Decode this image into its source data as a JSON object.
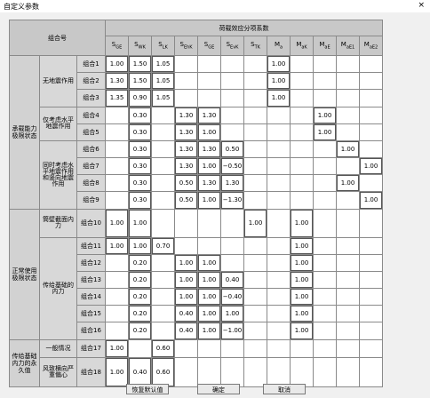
{
  "window": {
    "title": "自定义参数",
    "close_glyph": "×"
  },
  "table": {
    "corner_label": "组合号",
    "coeff_header": "荷载效应分项系数",
    "columns": [
      {
        "main": "S",
        "sub": "GE"
      },
      {
        "main": "S",
        "sub": "WK"
      },
      {
        "main": "S",
        "sub": "LK"
      },
      {
        "main": "S",
        "sub": "EhK"
      },
      {
        "main": "S",
        "sub": "GE"
      },
      {
        "main": "S",
        "sub": "EvK"
      },
      {
        "main": "S",
        "sub": "TK"
      },
      {
        "main": "M",
        "sub": "a"
      },
      {
        "main": "M",
        "sub": "aK"
      },
      {
        "main": "M",
        "sub": "aE"
      },
      {
        "main": "M",
        "sub": "aE1"
      },
      {
        "main": "M",
        "sub": "aE2"
      }
    ],
    "groups": [
      {
        "label": "承载能力极限状态",
        "subs": [
          {
            "label": "无地震作用",
            "rows": [
              {
                "label": "组合1",
                "values": [
                  "1.00",
                  "1.50",
                  "1.05",
                  "",
                  "",
                  "",
                  "",
                  "1.00",
                  "",
                  "",
                  "",
                  ""
                ]
              },
              {
                "label": "组合2",
                "values": [
                  "1.30",
                  "1.50",
                  "1.05",
                  "",
                  "",
                  "",
                  "",
                  "1.00",
                  "",
                  "",
                  "",
                  ""
                ]
              },
              {
                "label": "组合3",
                "values": [
                  "1.35",
                  "0.90",
                  "1.05",
                  "",
                  "",
                  "",
                  "",
                  "1.00",
                  "",
                  "",
                  "",
                  ""
                ]
              }
            ]
          },
          {
            "label": "仅考虑水平地震作用",
            "rows": [
              {
                "label": "组合4",
                "values": [
                  "",
                  "0.30",
                  "",
                  "1.30",
                  "1.30",
                  "",
                  "",
                  "",
                  "",
                  "1.00",
                  "",
                  ""
                ]
              },
              {
                "label": "组合5",
                "values": [
                  "",
                  "0.30",
                  "",
                  "1.30",
                  "1.00",
                  "",
                  "",
                  "",
                  "",
                  "1.00",
                  "",
                  ""
                ]
              }
            ]
          },
          {
            "label": "同时考虑水平地震作用和竖向地震作用",
            "rows": [
              {
                "label": "组合6",
                "values": [
                  "",
                  "0.30",
                  "",
                  "1.30",
                  "1.30",
                  "0.50",
                  "",
                  "",
                  "",
                  "",
                  "1.00",
                  ""
                ]
              },
              {
                "label": "组合7",
                "values": [
                  "",
                  "0.30",
                  "",
                  "1.30",
                  "1.00",
                  "−0.50",
                  "",
                  "",
                  "",
                  "",
                  "",
                  "1.00"
                ]
              },
              {
                "label": "组合8",
                "values": [
                  "",
                  "0.30",
                  "",
                  "0.50",
                  "1.30",
                  "1.30",
                  "",
                  "",
                  "",
                  "",
                  "1.00",
                  ""
                ]
              },
              {
                "label": "组合9",
                "values": [
                  "",
                  "0.30",
                  "",
                  "0.50",
                  "1.00",
                  "−1.30",
                  "",
                  "",
                  "",
                  "",
                  "",
                  "1.00"
                ]
              }
            ]
          }
        ]
      },
      {
        "label": "正常使用极限状态",
        "subs": [
          {
            "label": "筒壁截面内力",
            "rows": [
              {
                "label": "组合10",
                "values": [
                  "1.00",
                  "1.00",
                  "",
                  "",
                  "",
                  "",
                  "1.00",
                  "",
                  "1.00",
                  "",
                  "",
                  ""
                ]
              }
            ]
          },
          {
            "label": "传给基础的内力",
            "rows": [
              {
                "label": "组合11",
                "values": [
                  "1.00",
                  "1.00",
                  "0.70",
                  "",
                  "",
                  "",
                  "",
                  "",
                  "1.00",
                  "",
                  "",
                  ""
                ]
              },
              {
                "label": "组合12",
                "values": [
                  "",
                  "0.20",
                  "",
                  "1.00",
                  "1.00",
                  "",
                  "",
                  "",
                  "1.00",
                  "",
                  "",
                  ""
                ]
              },
              {
                "label": "组合13",
                "values": [
                  "",
                  "0.20",
                  "",
                  "1.00",
                  "1.00",
                  "0.40",
                  "",
                  "",
                  "1.00",
                  "",
                  "",
                  ""
                ]
              },
              {
                "label": "组合14",
                "values": [
                  "",
                  "0.20",
                  "",
                  "1.00",
                  "1.00",
                  "−0.40",
                  "",
                  "",
                  "1.00",
                  "",
                  "",
                  ""
                ]
              },
              {
                "label": "组合15",
                "values": [
                  "",
                  "0.20",
                  "",
                  "0.40",
                  "1.00",
                  "1.00",
                  "",
                  "",
                  "1.00",
                  "",
                  "",
                  ""
                ]
              },
              {
                "label": "组合16",
                "values": [
                  "",
                  "0.20",
                  "",
                  "0.40",
                  "1.00",
                  "−1.00",
                  "",
                  "",
                  "1.00",
                  "",
                  "",
                  ""
                ]
              }
            ]
          }
        ]
      },
      {
        "label": "传给基础内力的永久值",
        "subs": [
          {
            "label": "一般情况",
            "rows": [
              {
                "label": "组合17",
                "values": [
                  "1.00",
                  "",
                  "0.60",
                  "",
                  "",
                  "",
                  "",
                  "",
                  "",
                  "",
                  "",
                  ""
                ]
              }
            ]
          },
          {
            "label": "风致横向严重偏心",
            "rows": [
              {
                "label": "组合18",
                "values": [
                  "1.00",
                  "0.40",
                  "0.60",
                  "",
                  "",
                  "",
                  "",
                  "",
                  "",
                  "",
                  "",
                  ""
                ]
              }
            ]
          }
        ]
      }
    ]
  },
  "buttons": {
    "reset": "恢复默认值",
    "ok": "确定",
    "cancel": "取消"
  }
}
